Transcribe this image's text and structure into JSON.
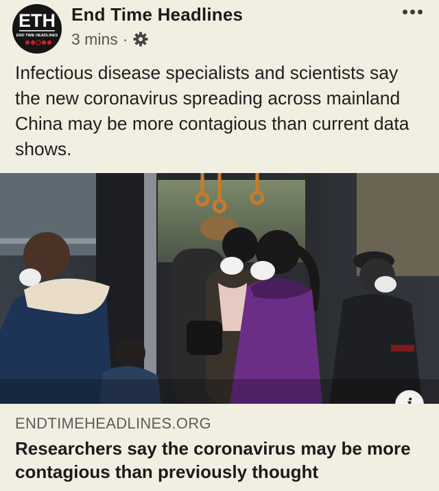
{
  "post": {
    "page_name": "End Time Headlines",
    "avatar_text": "ETH",
    "avatar_subtext": "END TIME HEADLINES",
    "timestamp": "3 mins",
    "separator": "·",
    "privacy_icon": "gear-icon",
    "more_icon": "more-options-icon",
    "body": "Infectious disease specialists and scientists say the new coronavirus spreading across mainland China may be more contagious than current data shows."
  },
  "link_preview": {
    "domain": "ENDTIMEHEADLINES.ORG",
    "title": "Researchers say the coronavirus may be more contagious than previously thought",
    "info_label": "i",
    "info_icon": "info-icon"
  },
  "colors": {
    "background": "#f1efe2",
    "avatar_accent": "#c8202a",
    "text": "#1b1b1b"
  }
}
